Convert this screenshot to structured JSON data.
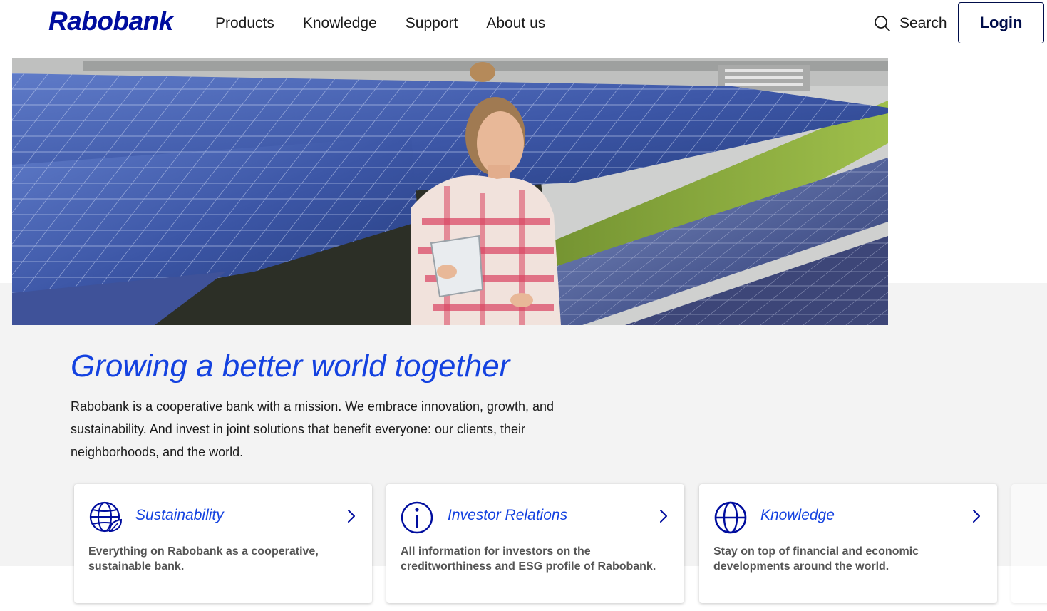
{
  "header": {
    "logo_text": "Rabobank",
    "nav": [
      {
        "label": "Products"
      },
      {
        "label": "Knowledge"
      },
      {
        "label": "Support"
      },
      {
        "label": "About us"
      }
    ],
    "search_label": "Search",
    "login_label": "Login"
  },
  "hero": {
    "image_alt": "Woman holding a clipboard inspecting solar panels"
  },
  "intro": {
    "headline": "Growing a better world together",
    "body": "Rabobank is a cooperative bank with a mission. We embrace innovation, growth, and sustainability. And invest in joint solutions that benefit everyone: our clients, their neighborhoods, and the world."
  },
  "cards": [
    {
      "title": "Sustainability",
      "description": "Everything on Rabobank as a cooperative, sustainable bank.",
      "icon": "globe-leaf-icon"
    },
    {
      "title": "Investor Relations",
      "description": "All information for investors on the creditworthiness and ESG profile of Rabobank.",
      "icon": "info-icon"
    },
    {
      "title": "Knowledge",
      "description": "Stay on top of financial and economic developments around the world.",
      "icon": "globe-icon"
    }
  ],
  "colors": {
    "brand_blue": "#000d9e",
    "accent_blue": "#1442e0",
    "text": "#1a1a1a",
    "muted_text": "#555555",
    "band_grey": "#f3f3f3"
  }
}
